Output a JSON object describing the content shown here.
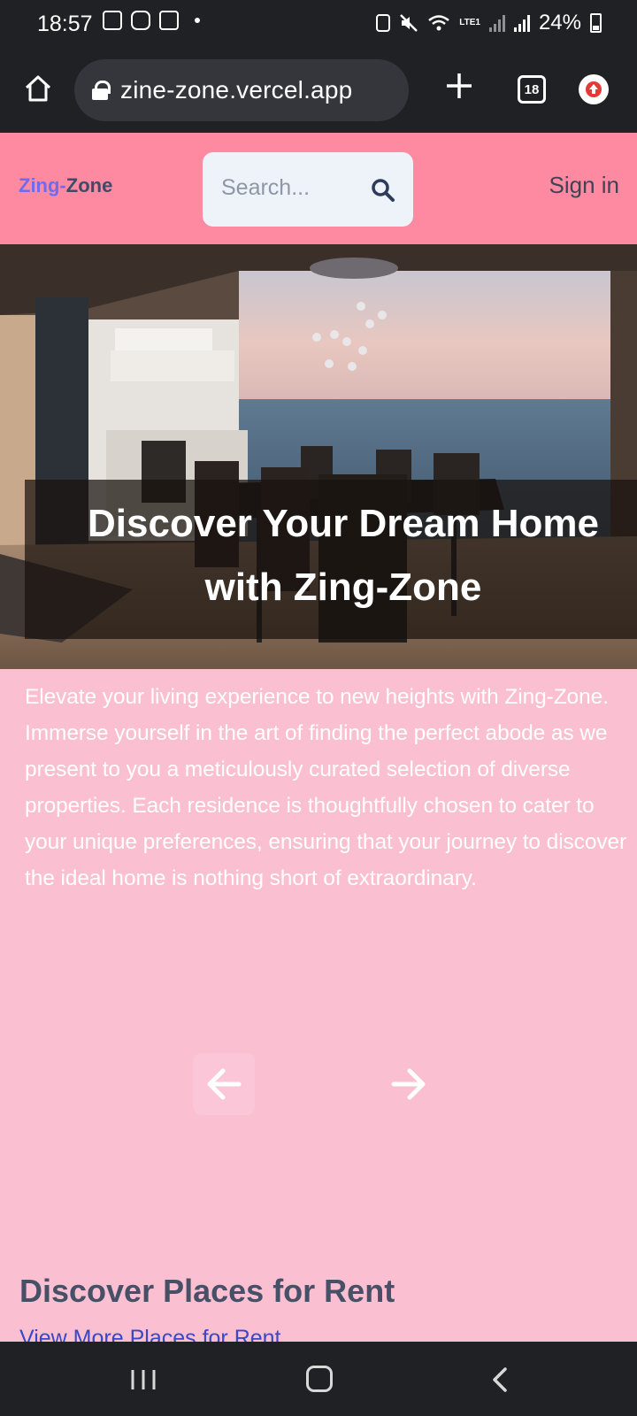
{
  "status_bar": {
    "time": "18:57",
    "battery": "24%",
    "network": "LTE1"
  },
  "browser": {
    "url": "zine-zone.vercel.app",
    "tab_count": "18"
  },
  "header": {
    "logo_part1": "Zing-",
    "logo_part2": "Zone",
    "search_placeholder": "Search...",
    "signin_label": "Sign in"
  },
  "hero": {
    "title_line1": "Discover Your Dream Home",
    "title_line2": "with Zing-Zone"
  },
  "intro": {
    "text": "Elevate your living experience to new heights with Zing-Zone. Immerse yourself in the art of finding the perfect abode as we present to you a meticulously curated selection of diverse properties. Each residence is thoughtfully chosen to cater to your unique preferences, ensuring that your journey to discover the ideal home is nothing short of extraordinary."
  },
  "rent_section": {
    "title": "Discover Places for Rent",
    "link": "View More Places for Rent"
  },
  "colors": {
    "header_bg": "#fd8aa0",
    "page_bg": "#fbbfd2",
    "logo_accent": "#6f6bf0",
    "logo_dark": "#3f4a6b",
    "link": "#3949c6"
  },
  "icons": [
    "home-icon",
    "lock-icon",
    "plus-icon",
    "tabs-icon",
    "update-icon",
    "search-icon",
    "arrow-left-icon",
    "arrow-right-icon"
  ]
}
